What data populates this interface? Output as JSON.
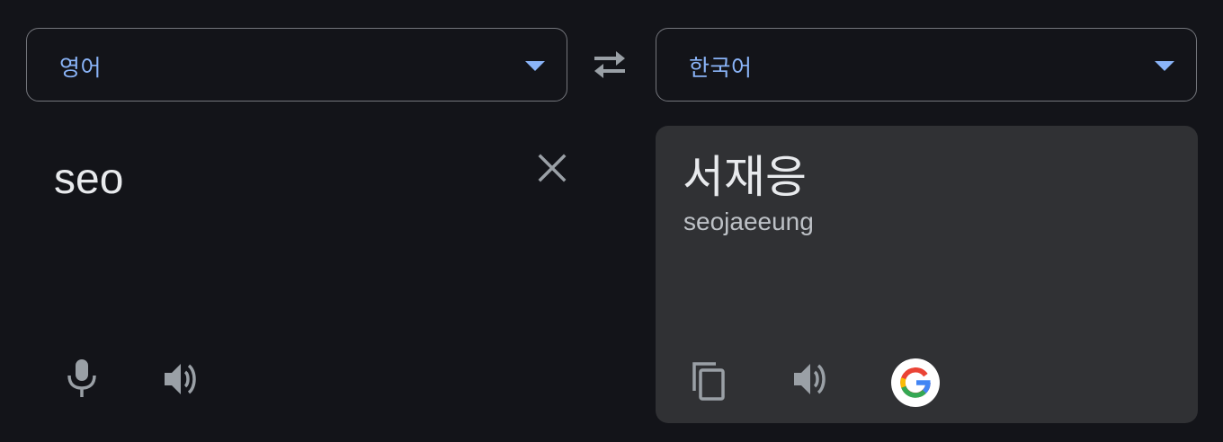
{
  "source_language": {
    "label": "영어",
    "icon": "chevron-down-icon"
  },
  "target_language": {
    "label": "한국어",
    "icon": "chevron-down-icon"
  },
  "swap": {
    "icon": "swap-arrows-icon"
  },
  "source": {
    "text": "seo",
    "clear_icon": "close-icon",
    "mic_icon": "microphone-icon",
    "speaker_icon": "speaker-icon"
  },
  "translation": {
    "text": "서재응",
    "romanization": "seojaeeung",
    "copy_icon": "copy-icon",
    "speaker_icon": "speaker-icon",
    "google_icon": "google-logo-icon"
  },
  "colors": {
    "background": "#131419",
    "panel": "#303134",
    "accent": "#8ab4f8",
    "icon": "#9aa0a6",
    "text": "#e8eaed"
  }
}
